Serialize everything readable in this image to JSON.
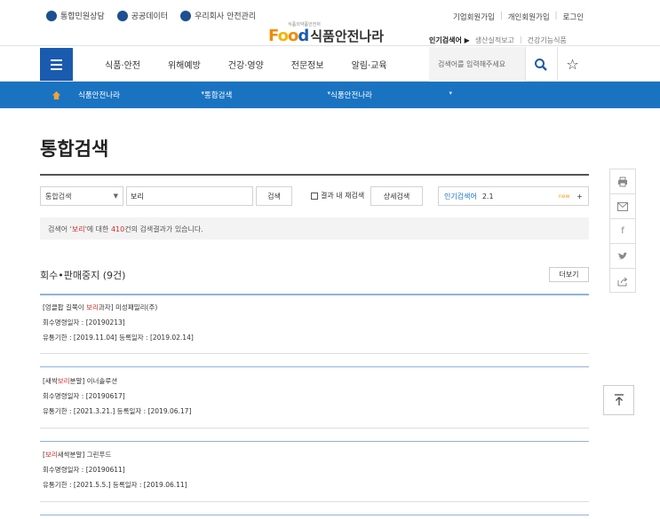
{
  "header": {
    "links": [
      "통합민원상담",
      "공공데이터",
      "우리회사 안전관리"
    ],
    "user_links": [
      "기업회원가입",
      "개인회원가입",
      "로그인"
    ],
    "logo_small": "식품의약품안전처",
    "logo_food": "Food",
    "logo_name": "식품안전나라",
    "popular_label": "인기검색어 ▶",
    "popular_terms": [
      "생산실적보고",
      "건강기능식품"
    ]
  },
  "nav": {
    "items": [
      "식품·안전",
      "위해예방",
      "건강·영양",
      "전문정보",
      "알림·교육"
    ],
    "search_placeholder": "검색어를 입력해주세요"
  },
  "breadcrumb": [
    "식품안전나라",
    "통합검색",
    "식품안전나라"
  ],
  "page": {
    "title": "통합검색"
  },
  "search": {
    "scope": "통합검색",
    "query": "보리",
    "search_btn": "검색",
    "within_label": "결과 내 재검색",
    "detail_btn": "상세검색",
    "popular_label": "인기검색어",
    "popular_value": "2.1",
    "popular_new": "new",
    "popular_plus": "+"
  },
  "result_info": {
    "pre": "검색어 '",
    "term": "보리",
    "mid": "'에 대한 ",
    "count": "410",
    "post": "건의 검색결과가 있습니다."
  },
  "section": {
    "title": "회수•판매중지 (9건)",
    "more": "더보기"
  },
  "results": [
    {
      "t1": "[엉클팝 길쭉이 ",
      "hl": "보리",
      "t2": "과자] 미성패밀리(주)",
      "line2": "회수명령일자 : [20190213]",
      "line3": "유통기한 : [2019.11.04] 등록일자 : [2019.02.14]"
    },
    {
      "t1": "[새싹",
      "hl": "보리",
      "t2": "분말] 이너솔루션",
      "line2": "회수명령일자 : [20190617]",
      "line3": "유통기한 : [2021.3.21.] 등록일자 : [2019.06.17]"
    },
    {
      "t1": "[",
      "hl": "보리",
      "t2": "새싹분말] 그린푸드",
      "line2": "회수명령일자 : [20190611]",
      "line3": "유통기한 : [2021.5.5.] 등록일자 : [2019.06.11]"
    }
  ],
  "side": {
    "icons": [
      "print-icon",
      "mail-icon",
      "facebook-icon",
      "twitter-icon",
      "share-icon"
    ],
    "top_icon": "arrow-up-icon"
  }
}
